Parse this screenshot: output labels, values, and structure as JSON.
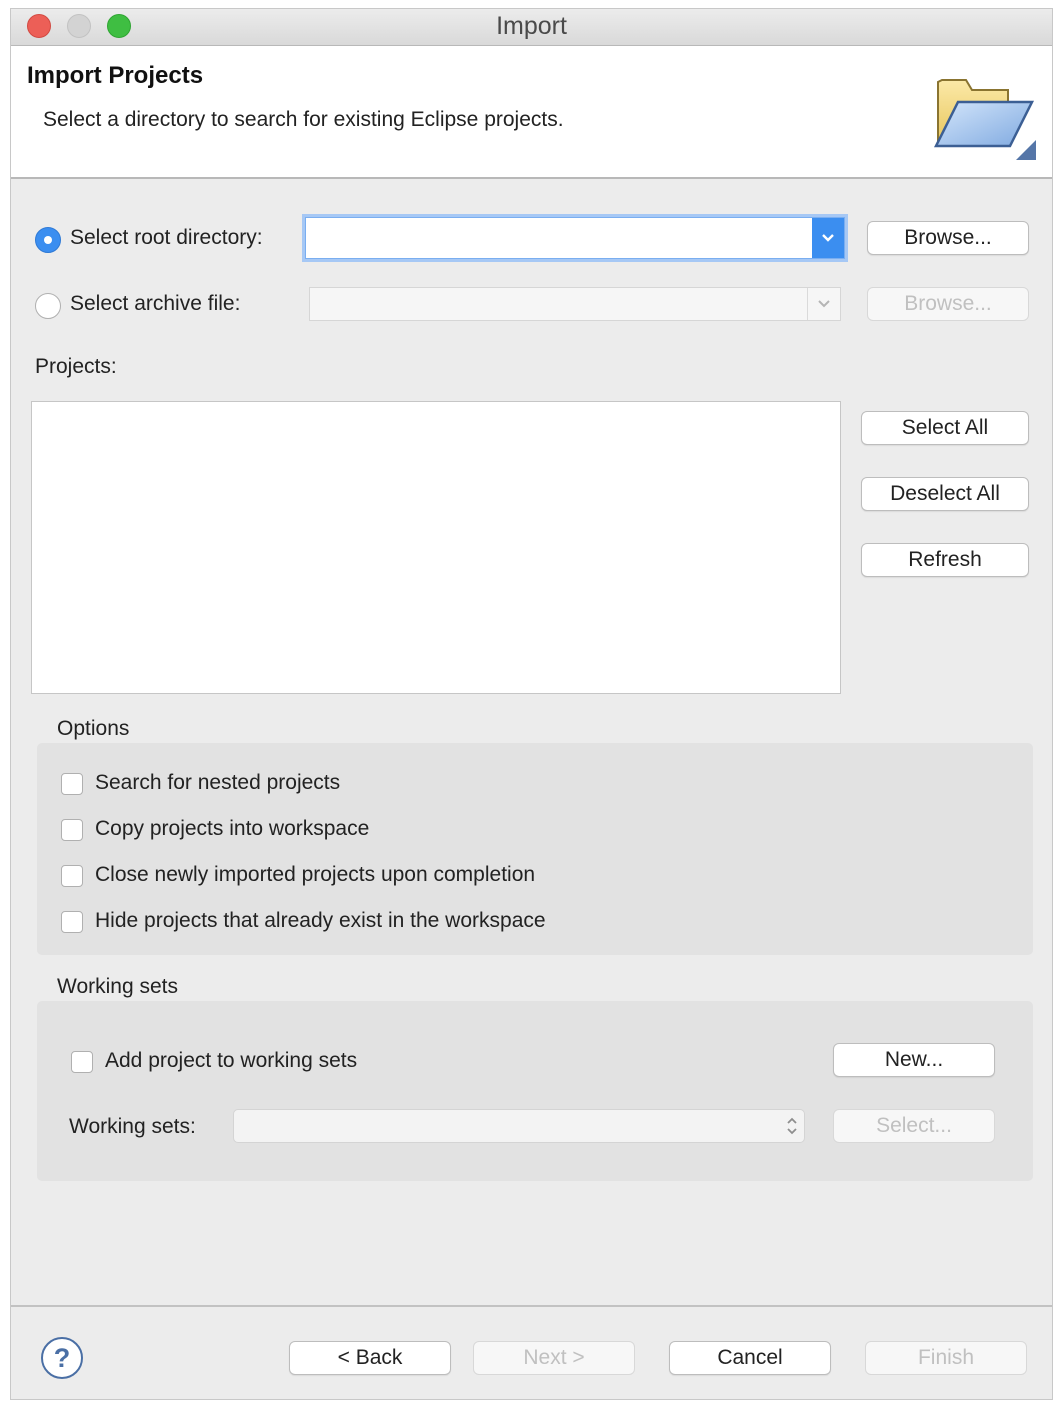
{
  "window": {
    "title": "Import"
  },
  "banner": {
    "title": "Import Projects",
    "description": "Select a directory to search for existing Eclipse projects.",
    "icon": "folder-icon"
  },
  "source": {
    "root_directory_label": "Select root directory:",
    "root_directory_value": "",
    "root_browse_label": "Browse...",
    "archive_file_label": "Select archive file:",
    "archive_file_value": "",
    "archive_browse_label": "Browse...",
    "selected": "root_directory"
  },
  "projects": {
    "label": "Projects:",
    "items": [],
    "select_all_label": "Select All",
    "deselect_all_label": "Deselect All",
    "refresh_label": "Refresh"
  },
  "options": {
    "title": "Options",
    "items": [
      {
        "label": "Search for nested projects",
        "checked": false
      },
      {
        "label": "Copy projects into workspace",
        "checked": false
      },
      {
        "label": "Close newly imported projects upon completion",
        "checked": false
      },
      {
        "label": "Hide projects that already exist in the workspace",
        "checked": false
      }
    ]
  },
  "working_sets": {
    "title": "Working sets",
    "add_label": "Add project to working sets",
    "add_checked": false,
    "new_label": "New...",
    "sets_label": "Working sets:",
    "sets_value": "",
    "select_label": "Select..."
  },
  "footer": {
    "help_symbol": "?",
    "back_label": "< Back",
    "next_label": "Next >",
    "cancel_label": "Cancel",
    "finish_label": "Finish"
  },
  "colors": {
    "accent": "#3b8ef0",
    "window_bg": "#ececec",
    "group_bg": "#e2e2e2",
    "disabled_text": "#b3b3b3"
  }
}
